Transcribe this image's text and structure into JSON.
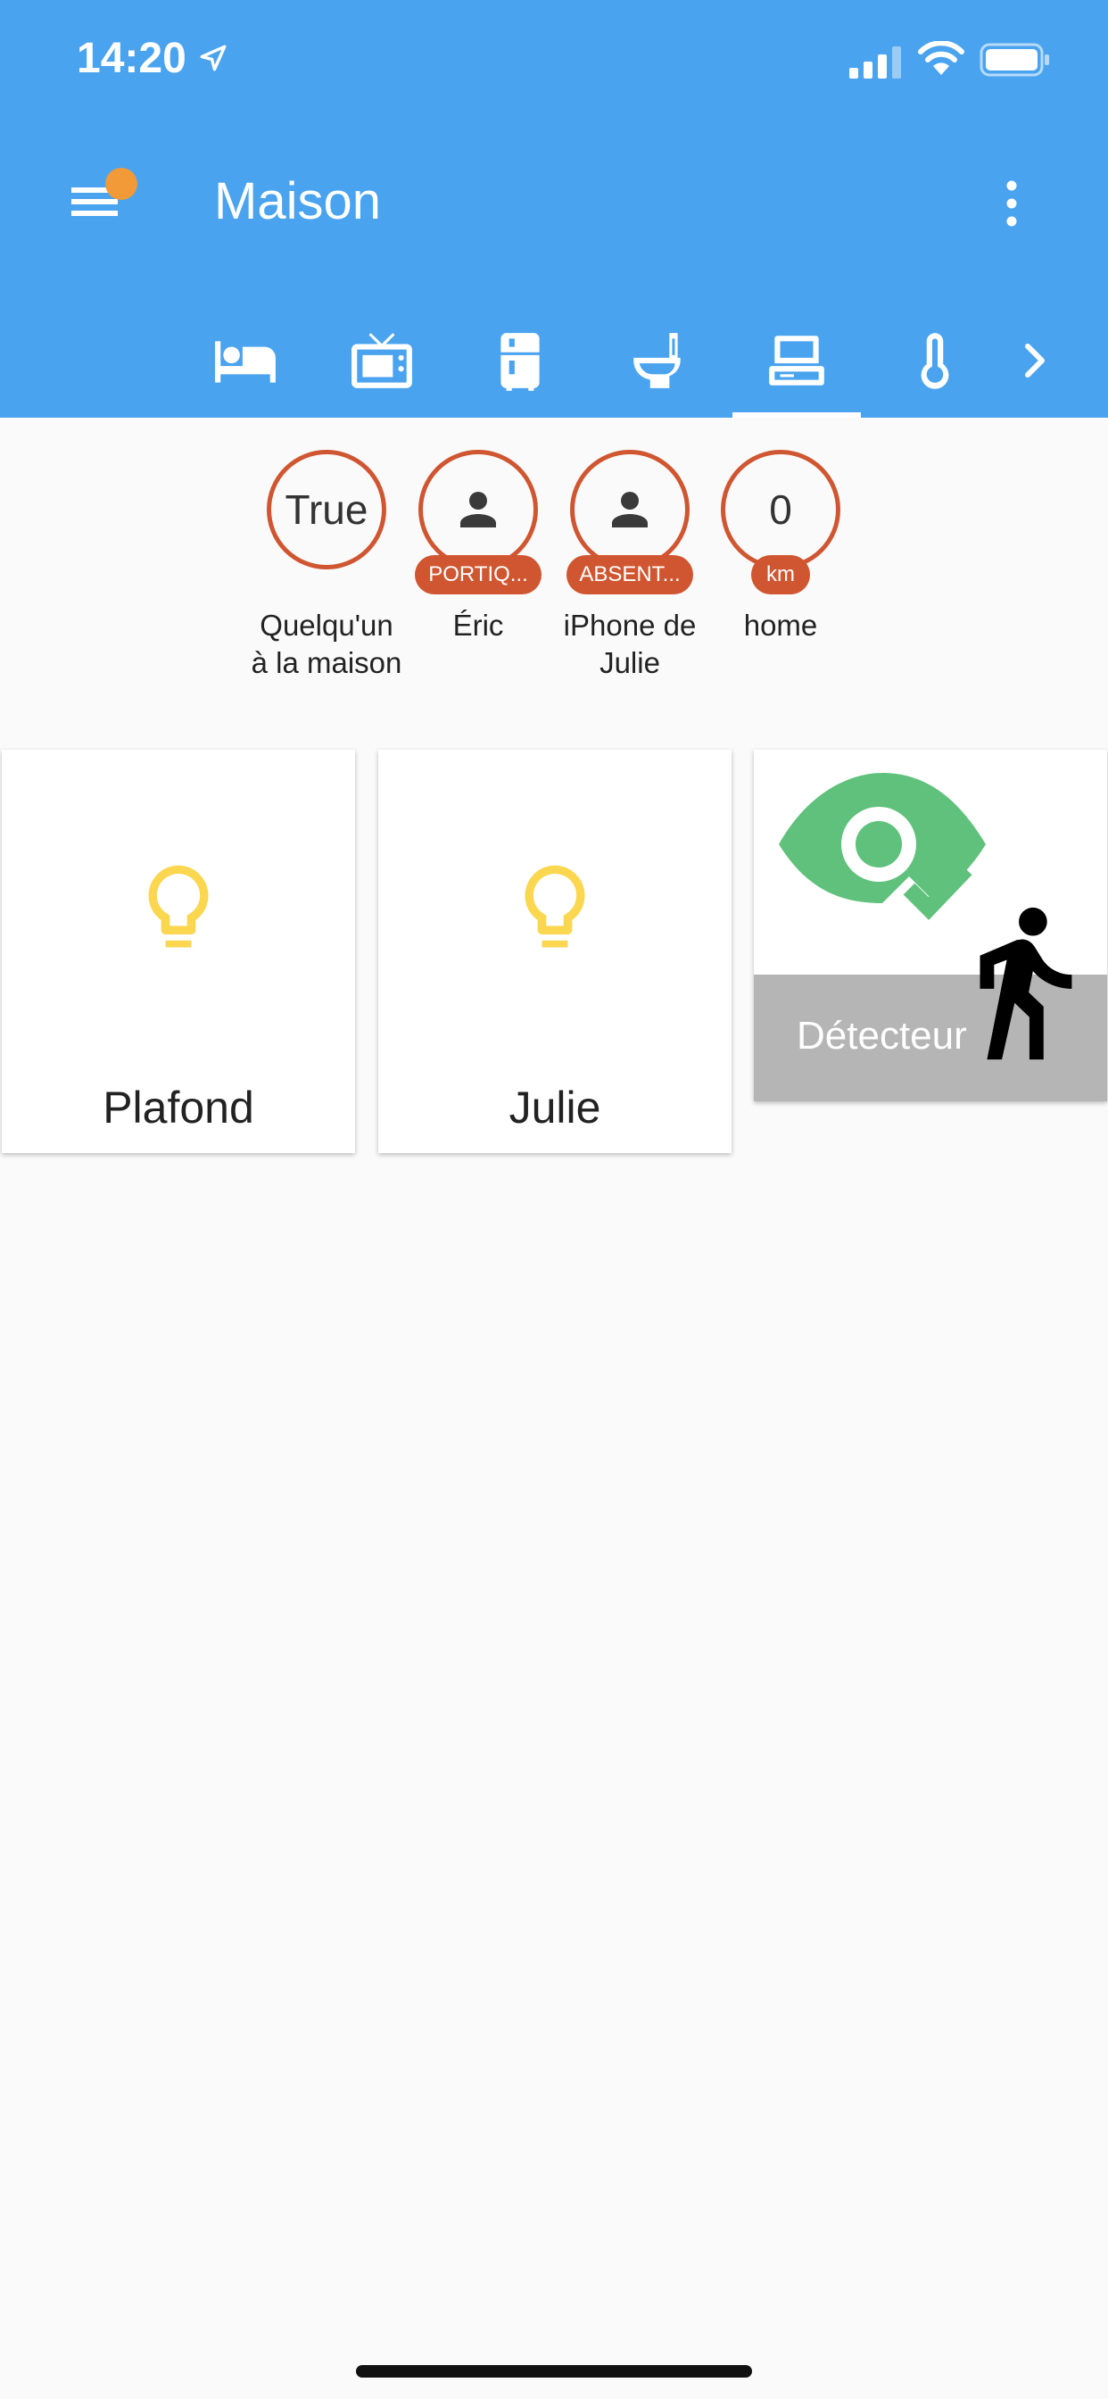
{
  "status_bar": {
    "time": "14:20"
  },
  "header": {
    "title": "Maison",
    "tab_icons": [
      "bed-icon",
      "tv-icon",
      "fridge-icon",
      "toilet-icon",
      "laptop-icon",
      "thermometer-icon"
    ],
    "active_tab": "laptop-icon",
    "colors": {
      "background": "#4aa3ee",
      "notification_dot": "#f19a37"
    }
  },
  "badges": [
    {
      "value": "True",
      "label": "",
      "name": "Quelqu'un à la maison"
    },
    {
      "icon": "person-icon",
      "label": "PORTIQ...",
      "name": "Éric"
    },
    {
      "icon": "person-icon",
      "label": "ABSENT...",
      "name": "iPhone de Julie"
    },
    {
      "value": "0",
      "label": "km",
      "name": "home"
    }
  ],
  "badge_color": "#cf5630",
  "cards": [
    {
      "name": "Plafond",
      "icon": "lightbulb-icon"
    },
    {
      "name": "Julie",
      "icon": "lightbulb-icon"
    },
    {
      "name": "Détecteur",
      "icon": "motion-sensor-icon"
    }
  ],
  "icon_color_light": "#fbd64f",
  "icon_color_sensor": "#5fc17c"
}
